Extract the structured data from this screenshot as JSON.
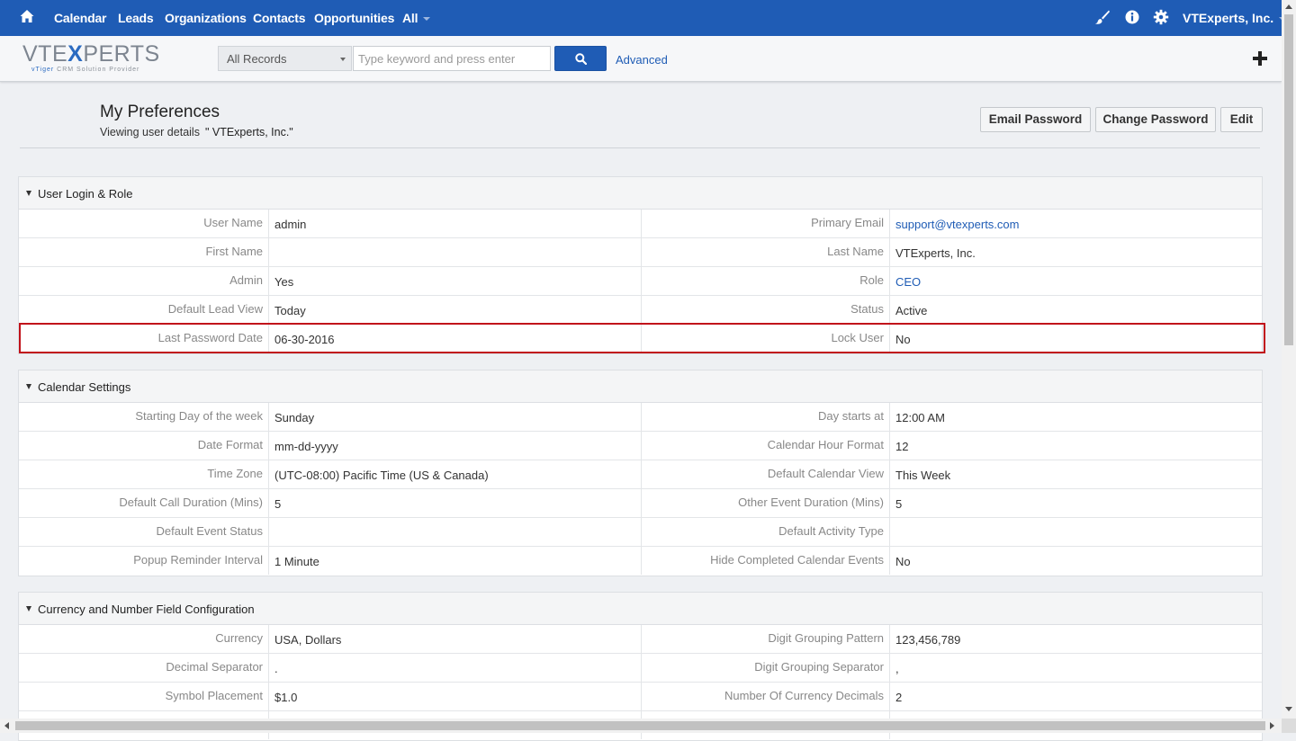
{
  "nav": {
    "items": [
      "Calendar",
      "Leads",
      "Organizations",
      "Contacts",
      "Opportunities",
      "All"
    ],
    "user": "VTExperts, Inc.",
    "icons": [
      "paintbrush-icon",
      "info-icon",
      "gear-icon"
    ]
  },
  "header": {
    "logo_text_pre": "VTE",
    "logo_text_x": "X",
    "logo_text_post": "PERTS",
    "logo_tagline_a": "vTiger",
    "logo_tagline_b": "CRM Solution Provider",
    "record_filter": "All Records",
    "search_placeholder": "Type keyword and press enter",
    "advanced_label": "Advanced"
  },
  "page": {
    "title": "My Preferences",
    "subtitle": "Viewing user details",
    "subtitle_user": "\" VTExperts, Inc.\"",
    "buttons": {
      "email_password": "Email Password",
      "change_password": "Change Password",
      "edit": "Edit"
    }
  },
  "sections": [
    {
      "title": "User Login & Role",
      "rows": [
        {
          "label1": "User Name",
          "value1": "admin",
          "label2": "Primary Email",
          "value2": "support@vtexperts.com"
        },
        {
          "label1": "First Name",
          "value1": "",
          "label2": "Last Name",
          "value2": "VTExperts, Inc."
        },
        {
          "label1": "Admin",
          "value1": "Yes",
          "label2": "Role",
          "value2": "CEO"
        },
        {
          "label1": "Default Lead View",
          "value1": "Today",
          "label2": "Status",
          "value2": "Active"
        },
        {
          "label1": "Last Password Date",
          "value1": "06-30-2016",
          "label2": "Lock User",
          "value2": "No"
        }
      ]
    },
    {
      "title": "Calendar Settings",
      "rows": [
        {
          "label1": "Starting Day of the week",
          "value1": "Sunday",
          "label2": "Day starts at",
          "value2": "12:00 AM"
        },
        {
          "label1": "Date Format",
          "value1": "mm-dd-yyyy",
          "label2": "Calendar Hour Format",
          "value2": "12"
        },
        {
          "label1": "Time Zone",
          "value1": "(UTC-08:00) Pacific Time (US & Canada)",
          "label2": "Default Calendar View",
          "value2": "This Week"
        },
        {
          "label1": "Default Call Duration (Mins)",
          "value1": "5",
          "label2": "Other Event Duration (Mins)",
          "value2": "5"
        },
        {
          "label1": "Default Event Status",
          "value1": "",
          "label2": "Default Activity Type",
          "value2": ""
        },
        {
          "label1": "Popup Reminder Interval",
          "value1": "1 Minute",
          "label2": "Hide Completed Calendar Events",
          "value2": "No"
        }
      ]
    },
    {
      "title": "Currency and Number Field Configuration",
      "rows": [
        {
          "label1": "Currency",
          "value1": "USA, Dollars",
          "label2": "Digit Grouping Pattern",
          "value2": "123,456,789"
        },
        {
          "label1": "Decimal Separator",
          "value1": ".",
          "label2": "Digit Grouping Separator",
          "value2": ","
        },
        {
          "label1": "Symbol Placement",
          "value1": "$1.0",
          "label2": "Number Of Currency Decimals",
          "value2": "2"
        },
        {
          "label1": "",
          "value1": "",
          "label2": "",
          "value2": ""
        }
      ]
    }
  ],
  "colors": {
    "nav_bg": "#1f5cb5",
    "link": "#1f5cb5",
    "highlight_border": "#c1121a"
  }
}
